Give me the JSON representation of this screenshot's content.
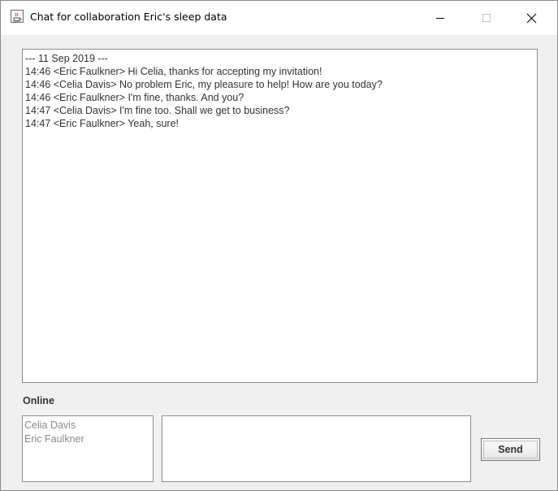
{
  "window": {
    "title": "Chat for collaboration Eric's sleep data",
    "controls": {
      "minimize_icon": "minimize-icon",
      "maximize_icon": "maximize-icon",
      "close_icon": "close-icon"
    },
    "app_icon": "java-cup-icon"
  },
  "chat": {
    "lines": [
      "--- 11 Sep 2019 ---",
      "14:46 <Eric Faulkner> Hi Celia, thanks for accepting my invitation!",
      "14:46 <Celia Davis> No problem Eric, my pleasure to help! How are you today?",
      "14:46 <Eric Faulkner> I'm fine, thanks. And you?",
      "14:47 <Celia Davis> I'm fine too. Shall we get to business?",
      "14:47 <Eric Faulkner> Yeah, sure!"
    ]
  },
  "online": {
    "label": "Online",
    "users": [
      "Celia Davis",
      "Eric Faulkner"
    ]
  },
  "compose": {
    "value": "",
    "send_label": "Send"
  },
  "colors": {
    "window_bg": "#f0f0f0",
    "titlebar_bg": "#ffffff",
    "text": "#333333",
    "muted_user": "#8a8a8a"
  }
}
